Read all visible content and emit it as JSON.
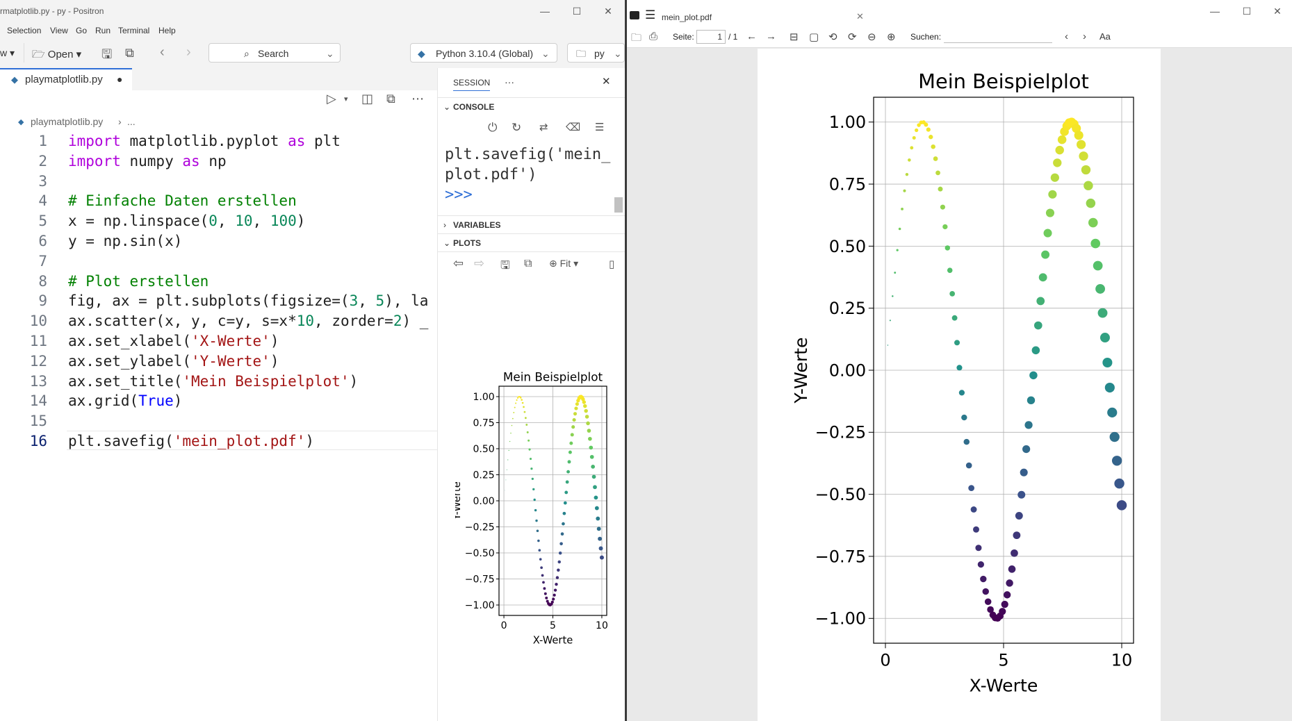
{
  "ide": {
    "window_title": "rmatplotlib.py - py - Positron",
    "menu": [
      "Selection",
      "View",
      "Go",
      "Run",
      "Terminal",
      "Help"
    ],
    "toolbar": {
      "left_cut": "w",
      "open_label": "Open",
      "search_label": "Search",
      "interpreter": "Python 3.10.4 (Global)",
      "folder": "py"
    },
    "editor": {
      "tab_label": "playmatplotlib.py",
      "breadcrumb_file": "playmatplotlib.py",
      "breadcrumb_rest": "...",
      "lines": [
        {
          "n": "1",
          "parts": [
            [
              "kw",
              "import"
            ],
            [
              "tx",
              " matplotlib.pyplot "
            ],
            [
              "kw",
              "as"
            ],
            [
              "tx",
              " plt"
            ]
          ]
        },
        {
          "n": "2",
          "parts": [
            [
              "kw",
              "import"
            ],
            [
              "tx",
              " numpy "
            ],
            [
              "kw",
              "as"
            ],
            [
              "tx",
              " np"
            ]
          ]
        },
        {
          "n": "3",
          "parts": []
        },
        {
          "n": "4",
          "parts": [
            [
              "cm",
              "# Einfache Daten erstellen"
            ]
          ]
        },
        {
          "n": "5",
          "parts": [
            [
              "tx",
              "x = np.linspace("
            ],
            [
              "nm",
              "0"
            ],
            [
              "tx",
              ", "
            ],
            [
              "nm",
              "10"
            ],
            [
              "tx",
              ", "
            ],
            [
              "nm",
              "100"
            ],
            [
              "tx",
              ")"
            ]
          ]
        },
        {
          "n": "6",
          "parts": [
            [
              "tx",
              "y = np.sin(x)"
            ]
          ]
        },
        {
          "n": "7",
          "parts": []
        },
        {
          "n": "8",
          "parts": [
            [
              "cm",
              "# Plot erstellen"
            ]
          ]
        },
        {
          "n": "9",
          "parts": [
            [
              "tx",
              "fig, ax = plt.subplots(figsize=("
            ],
            [
              "nm",
              "3"
            ],
            [
              "tx",
              ", "
            ],
            [
              "nm",
              "5"
            ],
            [
              "tx",
              "), la"
            ]
          ]
        },
        {
          "n": "10",
          "parts": [
            [
              "tx",
              "ax.scatter(x, y, c=y, s=x*"
            ],
            [
              "nm",
              "10"
            ],
            [
              "tx",
              ", zorder="
            ],
            [
              "nm",
              "2"
            ],
            [
              "tx",
              ") _"
            ]
          ]
        },
        {
          "n": "11",
          "parts": [
            [
              "tx",
              "ax.set_xlabel("
            ],
            [
              "st",
              "'X-Werte'"
            ],
            [
              "tx",
              ")"
            ]
          ]
        },
        {
          "n": "12",
          "parts": [
            [
              "tx",
              "ax.set_ylabel("
            ],
            [
              "st",
              "'Y-Werte'"
            ],
            [
              "tx",
              ")"
            ]
          ]
        },
        {
          "n": "13",
          "parts": [
            [
              "tx",
              "ax.set_title("
            ],
            [
              "st",
              "'Mein Beispielplot'"
            ],
            [
              "tx",
              ")"
            ]
          ]
        },
        {
          "n": "14",
          "parts": [
            [
              "tx",
              "ax.grid("
            ],
            [
              "bi",
              "True"
            ],
            [
              "tx",
              ")"
            ]
          ]
        },
        {
          "n": "15",
          "parts": []
        },
        {
          "n": "16",
          "parts": [
            [
              "tx",
              "plt.savefig("
            ],
            [
              "st",
              "'mein_plot.pdf'"
            ],
            [
              "tx",
              ")"
            ]
          ]
        }
      ]
    },
    "session": {
      "tab": "SESSION",
      "more": "···",
      "console_header": "CONSOLE",
      "console_line1": "plt.savefig('mein_",
      "console_line2": "plot.pdf')",
      "console_prompt": ">>>",
      "variables_header": "VARIABLES",
      "plots_header": "PLOTS",
      "fit_label": "Fit"
    }
  },
  "pdf": {
    "filename": "mein_plot.pdf",
    "page_label": "Seite:",
    "page_value": "1",
    "page_total": "/ 1",
    "search_label": "Suchen:",
    "font_glyph": "Aa"
  },
  "chart_data": {
    "type": "scatter",
    "title": "Mein Beispielplot",
    "xlabel": "X-Werte",
    "ylabel": "Y-Werte",
    "function": "y = sin(x), x = linspace(0, 10, 100), marker size = x*10, color = y (viridis)",
    "n_points": 100,
    "x_range": [
      0,
      10
    ],
    "xlim": [
      -0.5,
      10.5
    ],
    "ylim": [
      -1.1,
      1.1
    ],
    "x_ticks": [
      "0",
      "5",
      "10"
    ],
    "y_ticks": [
      "−1.00",
      "−0.75",
      "−0.50",
      "−0.25",
      "0.00",
      "0.25",
      "0.50",
      "0.75",
      "1.00"
    ],
    "y_tick_values": [
      -1.0,
      -0.75,
      -0.5,
      -0.25,
      0.0,
      0.25,
      0.5,
      0.75,
      1.0
    ],
    "x_tick_values": [
      0,
      5,
      10
    ],
    "grid": true,
    "colormap": [
      "#440154",
      "#3b528b",
      "#21918c",
      "#5ec962",
      "#fde725"
    ]
  }
}
